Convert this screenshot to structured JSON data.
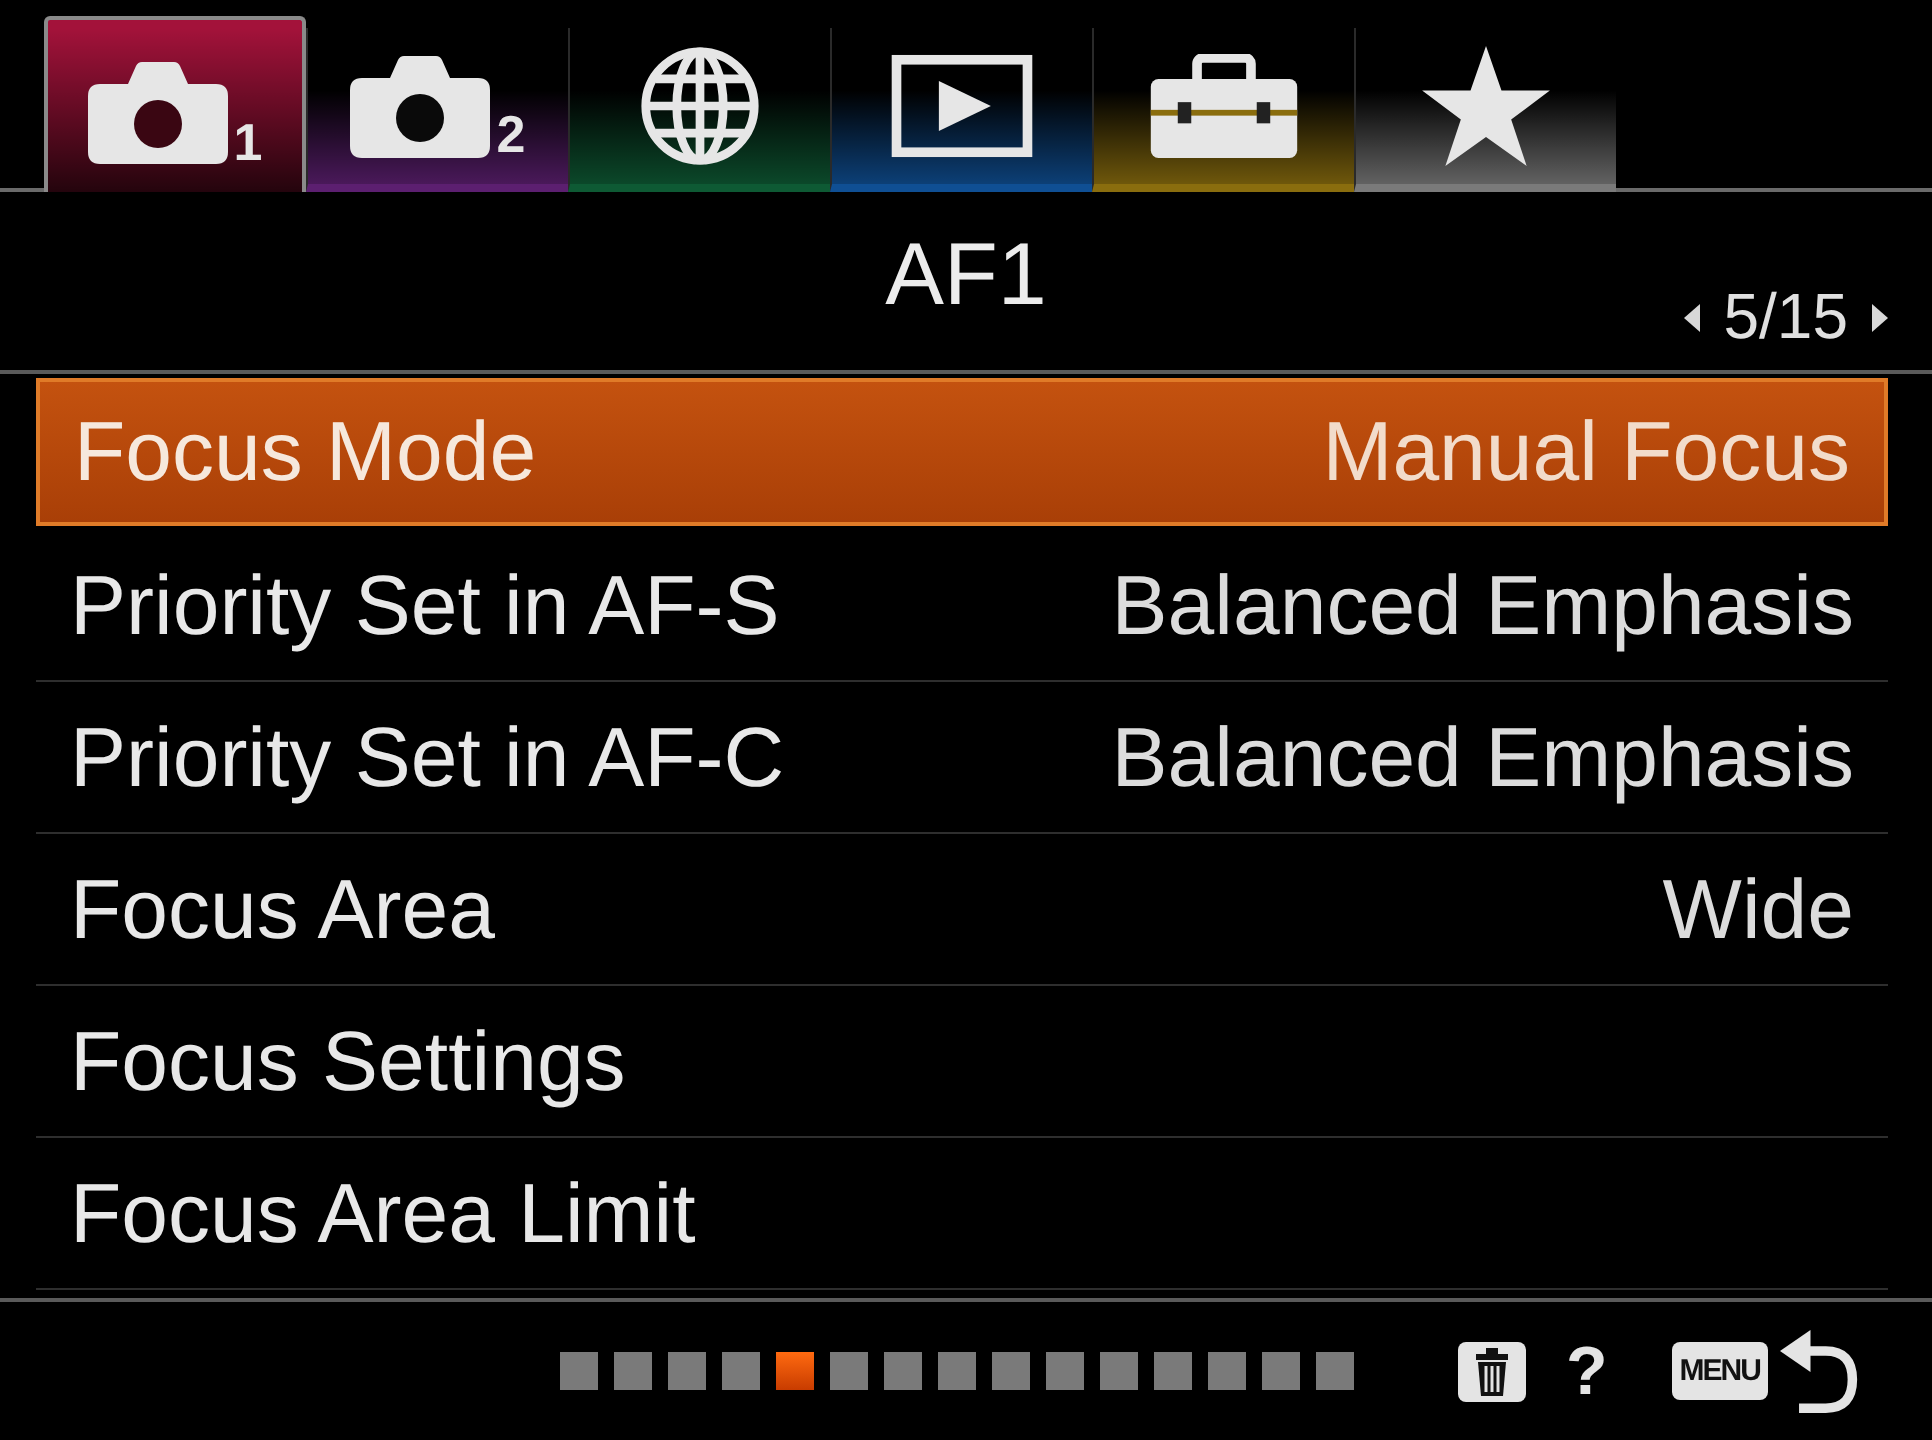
{
  "tabs": [
    {
      "kind": "camera",
      "subscript": "1",
      "color": "#a3123a",
      "selected": true
    },
    {
      "kind": "camera",
      "subscript": "2",
      "color": "#5c1f70",
      "selected": false
    },
    {
      "kind": "globe",
      "color": "#0e5a34",
      "selected": false
    },
    {
      "kind": "playback",
      "color": "#0f4f94",
      "selected": false
    },
    {
      "kind": "toolbox",
      "color": "#8a6d0e",
      "selected": false
    },
    {
      "kind": "star",
      "color": "#7a7a7a",
      "selected": false
    }
  ],
  "header": {
    "title": "AF1",
    "page": "5/15"
  },
  "menu_items": [
    {
      "label": "Focus Mode",
      "value": "Manual Focus",
      "selected": true
    },
    {
      "label": "Priority Set in AF-S",
      "value": "Balanced Emphasis",
      "selected": false
    },
    {
      "label": "Priority Set in AF-C",
      "value": "Balanced Emphasis",
      "selected": false
    },
    {
      "label": "Focus Area",
      "value": "Wide",
      "selected": false
    },
    {
      "label": "Focus Settings",
      "selected": false
    },
    {
      "label": "Focus Area Limit",
      "selected": false
    }
  ],
  "footer": {
    "page_dots": [
      {
        "selected": false
      },
      {
        "selected": false
      },
      {
        "selected": false
      },
      {
        "selected": false
      },
      {
        "selected": true
      },
      {
        "selected": false
      },
      {
        "selected": false
      },
      {
        "selected": false
      },
      {
        "selected": false
      },
      {
        "selected": false
      },
      {
        "selected": false
      },
      {
        "selected": false
      },
      {
        "selected": false
      },
      {
        "selected": false
      },
      {
        "selected": false
      }
    ],
    "help": "?",
    "menu_key": "MENU"
  }
}
